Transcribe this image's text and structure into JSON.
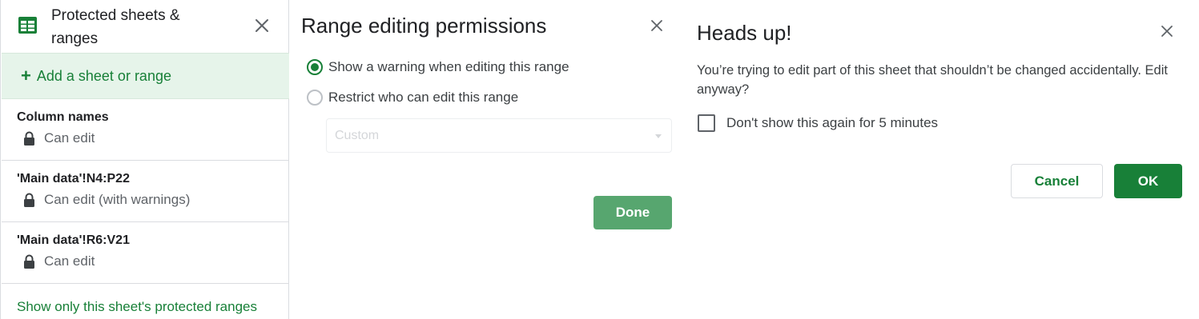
{
  "colors": {
    "accent": "#188038",
    "accent_light": "#e6f4ea",
    "done_button": "#57a66f",
    "text_primary": "#202124",
    "text_secondary": "#5f6368"
  },
  "protected_panel": {
    "icon": "google-sheets-icon",
    "title": "Protected sheets & ranges",
    "close_icon": "close-icon",
    "add_label": "Add a sheet or range",
    "ranges": [
      {
        "name": "Column names",
        "permission": "Can edit",
        "icon": "lock-icon"
      },
      {
        "name": "'Main data'!N4:P22",
        "permission": "Can edit (with warnings)",
        "icon": "lock-icon"
      },
      {
        "name": "'Main data'!R6:V21",
        "permission": "Can edit",
        "icon": "lock-icon"
      }
    ],
    "show_only_link": "Show only this sheet's protected ranges"
  },
  "permissions_panel": {
    "title": "Range editing permissions",
    "close_icon": "close-icon",
    "options": [
      {
        "label": "Show a warning when editing this range",
        "selected": true
      },
      {
        "label": "Restrict who can edit this range",
        "selected": false
      }
    ],
    "dropdown_value": "Custom",
    "dropdown_disabled": true,
    "done_label": "Done"
  },
  "warning_dialog": {
    "title": "Heads up!",
    "close_icon": "close-icon",
    "message": "You’re trying to edit part of this sheet that shouldn’t be changed accidentally. Edit anyway?",
    "checkbox_label": "Don't show this again for 5 minutes",
    "checkbox_checked": false,
    "cancel_label": "Cancel",
    "ok_label": "OK"
  }
}
